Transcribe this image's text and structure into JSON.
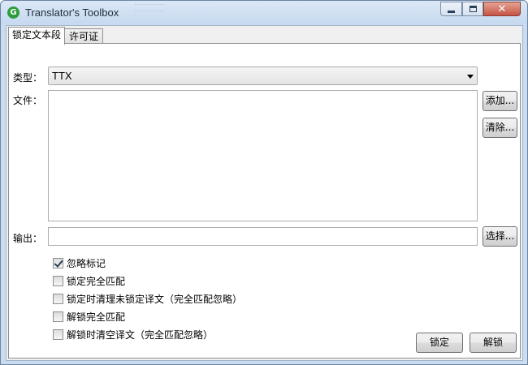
{
  "window": {
    "title": "Translator's Toolbox",
    "app_icon_letter": "G",
    "controls": {
      "minimize": "minimize",
      "maximize": "maximize",
      "close": "✕"
    }
  },
  "tabs": [
    {
      "label": "锁定文本段",
      "active": true
    },
    {
      "label": "许可证",
      "active": false
    }
  ],
  "form": {
    "type_label": "类型：",
    "type_value": "TTX",
    "files_label": "文件：",
    "output_label": "输出：",
    "output_value": ""
  },
  "buttons": {
    "add": "添加...",
    "clear": "清除...",
    "browse": "选择...",
    "lock": "锁定",
    "unlock": "解锁"
  },
  "options": [
    {
      "label": "忽略标记",
      "checked": true
    },
    {
      "label": "锁定完全匹配",
      "checked": false
    },
    {
      "label": "锁定时清理未锁定译文（完全匹配忽略）",
      "checked": false
    },
    {
      "label": "解锁完全匹配",
      "checked": false
    },
    {
      "label": "解锁时清空译文（完全匹配忽略）",
      "checked": false
    }
  ],
  "colors": {
    "accent_icon": "#2e9d3c",
    "close_button": "#c65445",
    "window_frame": "#c9dcf0"
  }
}
